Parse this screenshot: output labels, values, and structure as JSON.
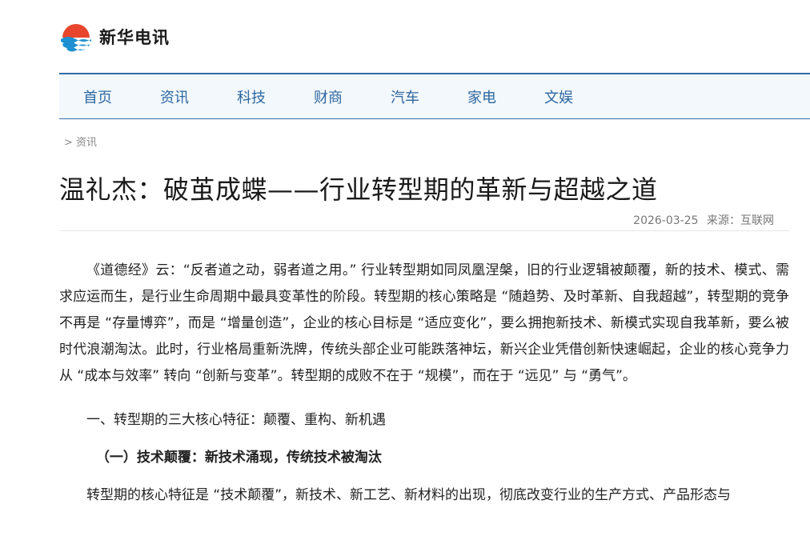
{
  "site": {
    "name": "新华电讯",
    "logo_icon": "wave-logo-icon",
    "brand_color": "#e8452c",
    "accent_color": "#2e6da4"
  },
  "nav": {
    "items": [
      "首页",
      "资讯",
      "科技",
      "财商",
      "汽车",
      "家电",
      "文娱"
    ]
  },
  "breadcrumb": {
    "text": "> 资讯"
  },
  "article": {
    "title": "温礼杰：破茧成蝶——行业转型期的革新与超越之道",
    "date": "2026-03-25",
    "source": "来源：互联网",
    "paragraph1": "《道德经》云：“反者道之动，弱者道之用。” 行业转型期如同凤凰涅槃，旧的行业逻辑被颠覆，新的技术、模式、需求应运而生，是行业生命周期中最具变革性的阶段。转型期的核心策略是 “随趋势、及时革新、自我超越”，转型期的竞争不再是 “存量博弈”，而是 “增量创造”，企业的核心目标是 “适应变化”，要么拥抱新技术、新模式实现自我革新，要么被时代浪潮淘汰。此时，行业格局重新洗牌，传统头部企业可能跌落神坛，新兴企业凭借创新快速崛起，企业的核心竞争力从 “成本与效率” 转向 “创新与变革”。转型期的成败不在于 “规模”，而在于 “远见” 与 “勇气”。",
    "section1": "一、转型期的三大核心特征：颠覆、重构、新机遇",
    "subsection1": "（一）技术颠覆：新技术涌现，传统技术被淘汰",
    "paragraph2": "转型期的核心特征是 “技术颠覆”，新技术、新工艺、新材料的出现，彻底改变行业的生产方式、产品形态与"
  }
}
